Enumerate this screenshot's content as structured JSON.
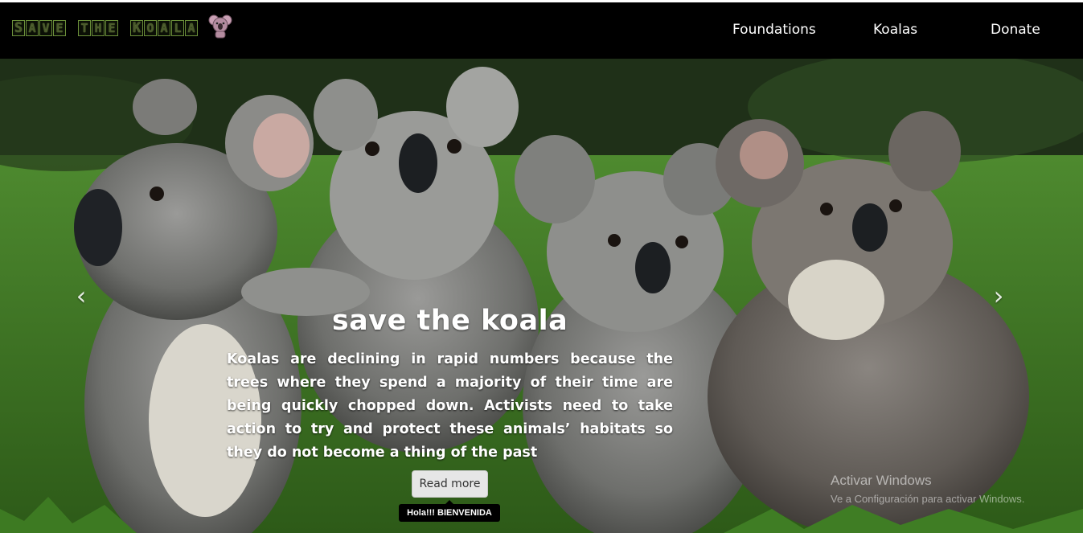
{
  "brand": {
    "logo_words": [
      {
        "letters": [
          "S",
          "a",
          "v",
          "e"
        ]
      },
      {
        "letters": [
          "t",
          "h",
          "e"
        ]
      },
      {
        "letters": [
          "K",
          "o",
          "a",
          "l",
          "a"
        ]
      }
    ],
    "logo_text": "Save the Koala",
    "logo_icon": "koala-icon"
  },
  "nav": {
    "items": [
      {
        "label": "Foundations"
      },
      {
        "label": "Koalas"
      },
      {
        "label": "Donate"
      }
    ]
  },
  "carousel": {
    "prev_icon": "chevron-left-icon",
    "next_icon": "chevron-right-icon",
    "caption": {
      "title": "save the koala",
      "text": "Koalas are declining in rapid numbers because the trees where they spend a majority of their time are being quickly chopped down. Activists need to take action to try and protect these animals’ habitats so they do not become a thing of the past",
      "button_label": "Read more",
      "tooltip": "Hola!!! BIENVENIDA"
    }
  },
  "watermark": {
    "title": "Activar Windows",
    "subtitle": "Ve a Configuración para activar Windows."
  },
  "colors": {
    "navbar_bg": "#000000",
    "nav_text": "#ffffff",
    "logo_border": "#6b8f3a",
    "button_bg": "#e6e6e6"
  }
}
